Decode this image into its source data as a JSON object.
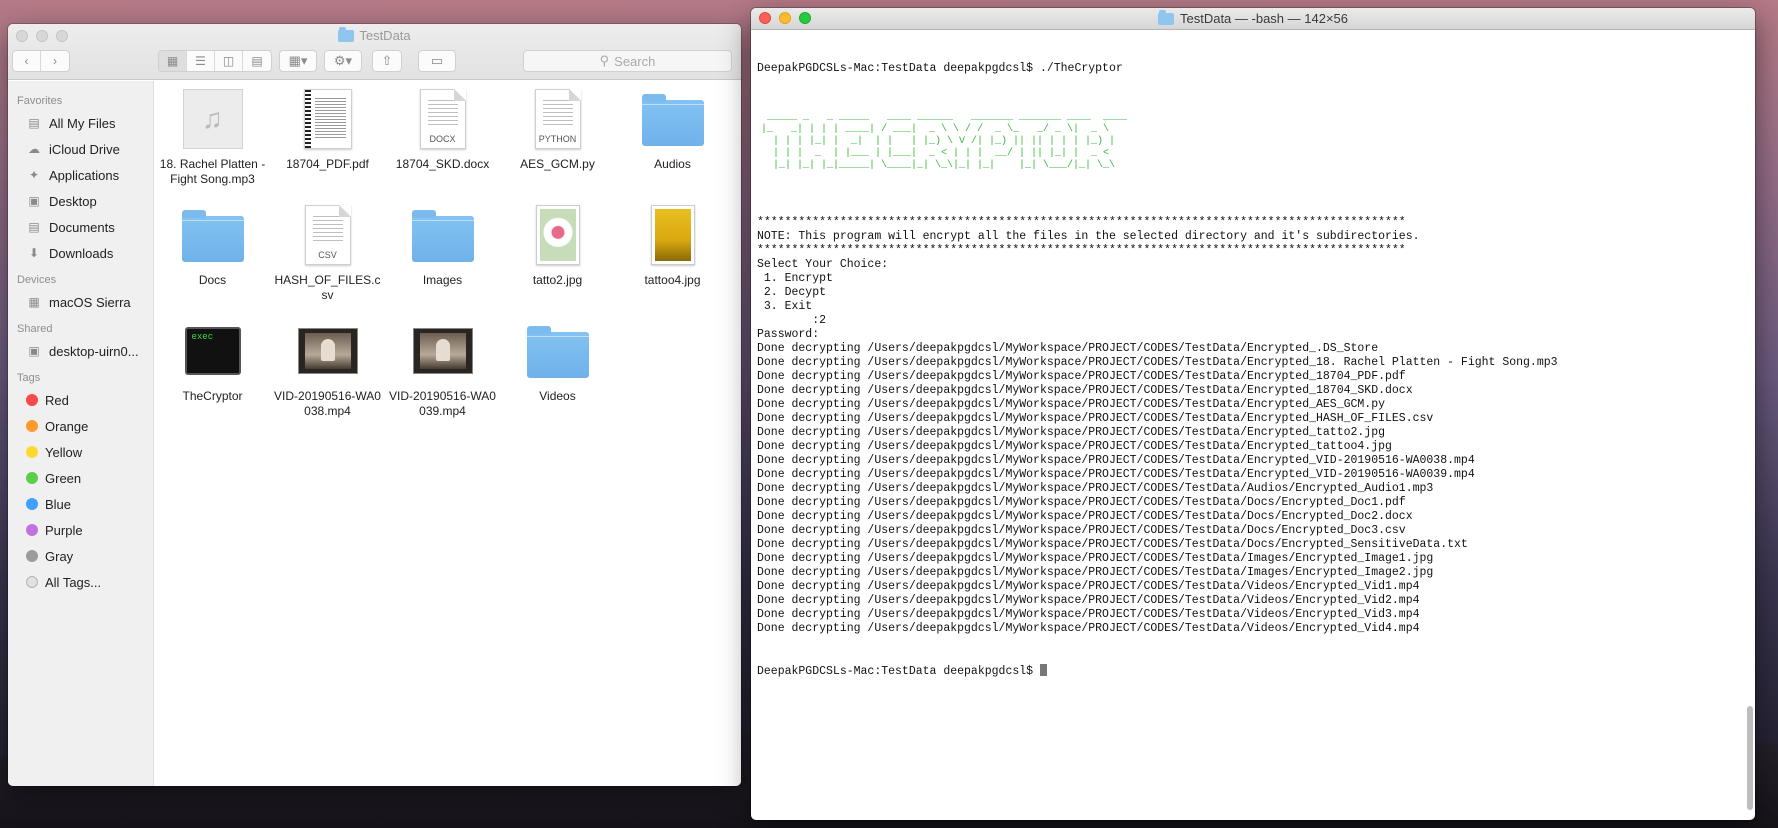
{
  "finder": {
    "title": "TestData",
    "search_placeholder": "Search",
    "sidebar": {
      "favorites_header": "Favorites",
      "favorites": [
        {
          "label": "All My Files",
          "icon": "all-files-icon"
        },
        {
          "label": "iCloud Drive",
          "icon": "cloud-icon"
        },
        {
          "label": "Applications",
          "icon": "applications-icon"
        },
        {
          "label": "Desktop",
          "icon": "desktop-icon"
        },
        {
          "label": "Documents",
          "icon": "documents-icon"
        },
        {
          "label": "Downloads",
          "icon": "downloads-icon"
        }
      ],
      "devices_header": "Devices",
      "devices": [
        {
          "label": "macOS Sierra",
          "icon": "disk-icon"
        }
      ],
      "shared_header": "Shared",
      "shared": [
        {
          "label": "desktop-uirn0...",
          "icon": "computer-icon"
        }
      ],
      "tags_header": "Tags",
      "tags": [
        {
          "label": "Red",
          "color": "#fc4a4a"
        },
        {
          "label": "Orange",
          "color": "#fd9a2d"
        },
        {
          "label": "Yellow",
          "color": "#fdd92e"
        },
        {
          "label": "Green",
          "color": "#5ad049"
        },
        {
          "label": "Blue",
          "color": "#3ea3f8"
        },
        {
          "label": "Purple",
          "color": "#c471e0"
        },
        {
          "label": "Gray",
          "color": "#9b9b9b"
        },
        {
          "label": "All Tags...",
          "color": "#e0e0e0"
        }
      ]
    },
    "files": [
      {
        "name": "18. Rachel Platten - Fight Song.mp3",
        "type": "audio"
      },
      {
        "name": "18704_PDF.pdf",
        "type": "pdf"
      },
      {
        "name": "18704_SKD.docx",
        "type": "doc",
        "ext": "DOCX"
      },
      {
        "name": "AES_GCM.py",
        "type": "doc",
        "ext": "PYTHON"
      },
      {
        "name": "Audios",
        "type": "folder"
      },
      {
        "name": "Docs",
        "type": "folder"
      },
      {
        "name": "HASH_OF_FILES.csv",
        "type": "doc",
        "ext": "CSV"
      },
      {
        "name": "Images",
        "type": "folder"
      },
      {
        "name": "tatto2.jpg",
        "type": "image1"
      },
      {
        "name": "tattoo4.jpg",
        "type": "image2"
      },
      {
        "name": "TheCryptor",
        "type": "exec",
        "ext": "exec"
      },
      {
        "name": "VID-20190516-WA0038.mp4",
        "type": "video"
      },
      {
        "name": "VID-20190516-WA0039.mp4",
        "type": "video"
      },
      {
        "name": "Videos",
        "type": "folder"
      }
    ]
  },
  "terminal": {
    "title": "TestData — -bash — 142×56",
    "prompt_command": "DeepakPGDCSLs-Mac:TestData deepakpgdcsl$ ./TheCryptor",
    "banner": [
      " _____ _   _ _____   ____ ______   _______ _______ ____  ____  ",
      "|_   _| | | | ____| / ___|  _ \\ \\ / /  _ \\_   _/ _ \\|  _ \\ ",
      "  | | | |_| |  _|  | |   | |_) \\ V /| |_) || || | | | |_) |",
      "  | | |  _  | |___ | |___|  _ < | | |  __/ | || |_| |  _ < ",
      "  |_| |_| |_|_____| \\____|_| \\_\\|_| |_|    |_| \\___/|_| \\_\\"
    ],
    "lines": [
      "**********************************************************************************************",
      "NOTE: This program will encrypt all the files in the selected directory and it's subdirectories.",
      "**********************************************************************************************",
      "Select Your Choice:",
      " 1. Encrypt",
      " 2. Decypt",
      " 3. Exit",
      "        :2",
      "Password:",
      "Done decrypting /Users/deepakpgdcsl/MyWorkspace/PROJECT/CODES/TestData/Encrypted_.DS_Store",
      "Done decrypting /Users/deepakpgdcsl/MyWorkspace/PROJECT/CODES/TestData/Encrypted_18. Rachel Platten - Fight Song.mp3",
      "Done decrypting /Users/deepakpgdcsl/MyWorkspace/PROJECT/CODES/TestData/Encrypted_18704_PDF.pdf",
      "Done decrypting /Users/deepakpgdcsl/MyWorkspace/PROJECT/CODES/TestData/Encrypted_18704_SKD.docx",
      "Done decrypting /Users/deepakpgdcsl/MyWorkspace/PROJECT/CODES/TestData/Encrypted_AES_GCM.py",
      "Done decrypting /Users/deepakpgdcsl/MyWorkspace/PROJECT/CODES/TestData/Encrypted_HASH_OF_FILES.csv",
      "Done decrypting /Users/deepakpgdcsl/MyWorkspace/PROJECT/CODES/TestData/Encrypted_tatto2.jpg",
      "Done decrypting /Users/deepakpgdcsl/MyWorkspace/PROJECT/CODES/TestData/Encrypted_tattoo4.jpg",
      "Done decrypting /Users/deepakpgdcsl/MyWorkspace/PROJECT/CODES/TestData/Encrypted_VID-20190516-WA0038.mp4",
      "Done decrypting /Users/deepakpgdcsl/MyWorkspace/PROJECT/CODES/TestData/Encrypted_VID-20190516-WA0039.mp4",
      "Done decrypting /Users/deepakpgdcsl/MyWorkspace/PROJECT/CODES/TestData/Audios/Encrypted_Audio1.mp3",
      "Done decrypting /Users/deepakpgdcsl/MyWorkspace/PROJECT/CODES/TestData/Docs/Encrypted_Doc1.pdf",
      "Done decrypting /Users/deepakpgdcsl/MyWorkspace/PROJECT/CODES/TestData/Docs/Encrypted_Doc2.docx",
      "Done decrypting /Users/deepakpgdcsl/MyWorkspace/PROJECT/CODES/TestData/Docs/Encrypted_Doc3.csv",
      "Done decrypting /Users/deepakpgdcsl/MyWorkspace/PROJECT/CODES/TestData/Docs/Encrypted_SensitiveData.txt",
      "Done decrypting /Users/deepakpgdcsl/MyWorkspace/PROJECT/CODES/TestData/Images/Encrypted_Image1.jpg",
      "Done decrypting /Users/deepakpgdcsl/MyWorkspace/PROJECT/CODES/TestData/Images/Encrypted_Image2.jpg",
      "Done decrypting /Users/deepakpgdcsl/MyWorkspace/PROJECT/CODES/TestData/Videos/Encrypted_Vid1.mp4",
      "Done decrypting /Users/deepakpgdcsl/MyWorkspace/PROJECT/CODES/TestData/Videos/Encrypted_Vid2.mp4",
      "Done decrypting /Users/deepakpgdcsl/MyWorkspace/PROJECT/CODES/TestData/Videos/Encrypted_Vid3.mp4",
      "Done decrypting /Users/deepakpgdcsl/MyWorkspace/PROJECT/CODES/TestData/Videos/Encrypted_Vid4.mp4"
    ],
    "final_prompt": "DeepakPGDCSLs-Mac:TestData deepakpgdcsl$ "
  }
}
